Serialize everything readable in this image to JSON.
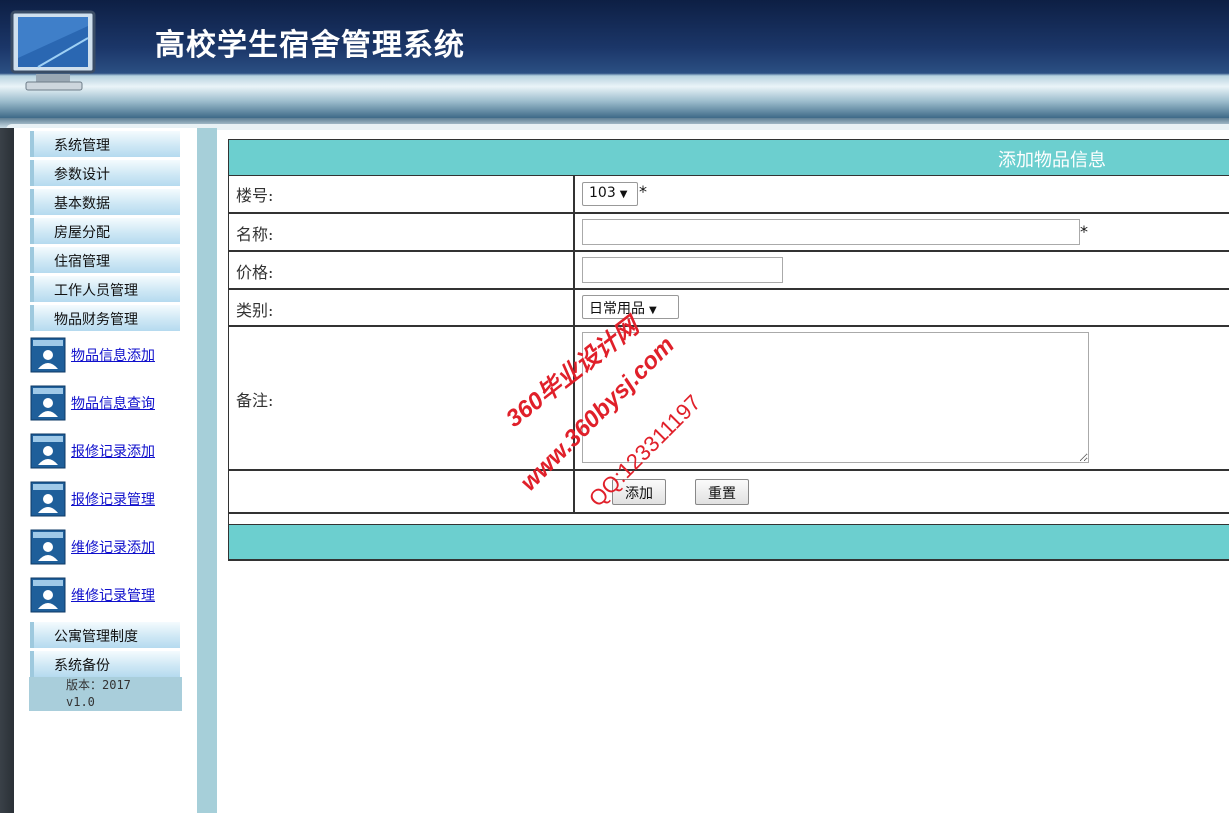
{
  "header": {
    "title": "高校学生宿舍管理系统"
  },
  "sidebar": {
    "menu_top": [
      {
        "label": "系统管理"
      },
      {
        "label": "参数设计"
      },
      {
        "label": "基本数据"
      },
      {
        "label": "房屋分配"
      },
      {
        "label": "住宿管理"
      },
      {
        "label": "工作人员管理"
      },
      {
        "label": "物品财务管理"
      }
    ],
    "sub_items": [
      {
        "label": "物品信息添加"
      },
      {
        "label": "物品信息查询"
      },
      {
        "label": "报修记录添加"
      },
      {
        "label": "报修记录管理"
      },
      {
        "label": "维修记录添加"
      },
      {
        "label": "维修记录管理"
      }
    ],
    "menu_bottom": [
      {
        "label": "公寓管理制度"
      },
      {
        "label": "系统备份"
      }
    ],
    "version_line1": "版本：2017",
    "version_line2": "v1.0"
  },
  "form": {
    "title": "添加物品信息",
    "fields": {
      "building": {
        "label": "楼号:",
        "value": "103",
        "required_mark": "*"
      },
      "name": {
        "label": "名称:",
        "value": "",
        "required_mark": "*"
      },
      "price": {
        "label": "价格:",
        "value": ""
      },
      "category": {
        "label": "类别:",
        "value": "日常用品"
      },
      "remark": {
        "label": "备注:",
        "value": ""
      }
    },
    "buttons": {
      "add": "添加",
      "reset": "重置"
    }
  },
  "watermark": {
    "line1": "360毕业设计网",
    "line2": "www.360bysj.com",
    "line3": "QQ:123311197"
  },
  "colors": {
    "form_header_bg": "#6ccfcf",
    "sidebar_gap": "#a6cfd9",
    "link": "#1010cc",
    "watermark": "#e0202a"
  }
}
